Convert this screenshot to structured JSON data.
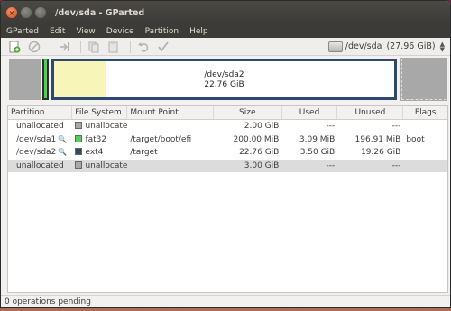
{
  "window": {
    "title": "/dev/sda - GParted"
  },
  "menu": [
    "GParted",
    "Edit",
    "View",
    "Device",
    "Partition",
    "Help"
  ],
  "device": {
    "label": "/dev/sda",
    "size": "(27.96 GiB)"
  },
  "diskmap": {
    "main_partition": "/dev/sda2",
    "main_size": "22.76 GiB"
  },
  "columns": [
    "Partition",
    "File System",
    "Mount Point",
    "Size",
    "Used",
    "Unused",
    "Flags"
  ],
  "rows": [
    {
      "partition": "unallocated",
      "fs": "unallocated",
      "fs_color": "#a8a8a8",
      "mount": "",
      "size": "2.00 GiB",
      "used": "---",
      "unused": "---",
      "flags": ""
    },
    {
      "partition": "/dev/sda1",
      "fs": "fat32",
      "fs_color": "#4cd44c",
      "mount": "/target/boot/efi",
      "size": "200.00 MiB",
      "used": "3.09 MiB",
      "unused": "196.91 MiB",
      "flags": "boot"
    },
    {
      "partition": "/dev/sda2",
      "fs": "ext4",
      "fs_color": "#2b4a6e",
      "mount": "/target",
      "size": "22.76 GiB",
      "used": "3.50 GiB",
      "unused": "19.26 GiB",
      "flags": ""
    },
    {
      "partition": "unallocated",
      "fs": "unallocated",
      "fs_color": "#a8a8a8",
      "mount": "",
      "size": "3.00 GiB",
      "used": "---",
      "unused": "---",
      "flags": ""
    }
  ],
  "status": "0 operations pending"
}
